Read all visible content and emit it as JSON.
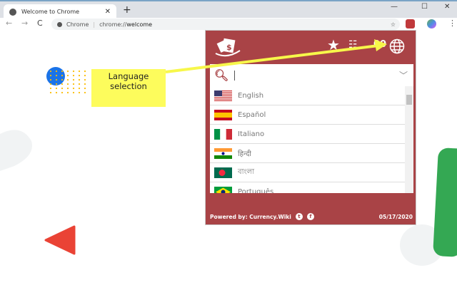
{
  "browser": {
    "tab_title": "Welcome to Chrome",
    "omnibox_site": "Chrome",
    "omnibox_url_prefix": "chrome://",
    "omnibox_url_host": "welcome"
  },
  "popup": {
    "search_placeholder": "",
    "languages": [
      {
        "name": "English",
        "flag": "us"
      },
      {
        "name": "Español",
        "flag": "es"
      },
      {
        "name": "Italiano",
        "flag": "it"
      },
      {
        "name": "हिन्दी",
        "flag": "in"
      },
      {
        "name": "বাংলা",
        "flag": "bd"
      },
      {
        "name": "Português",
        "flag": "br"
      }
    ],
    "footer": {
      "powered_by": "Powered by: Currency.Wiki",
      "date": "05/17/2020"
    },
    "color": "#a94346"
  },
  "annotation": {
    "text": "Language selection",
    "color": "#fdfc5c"
  }
}
